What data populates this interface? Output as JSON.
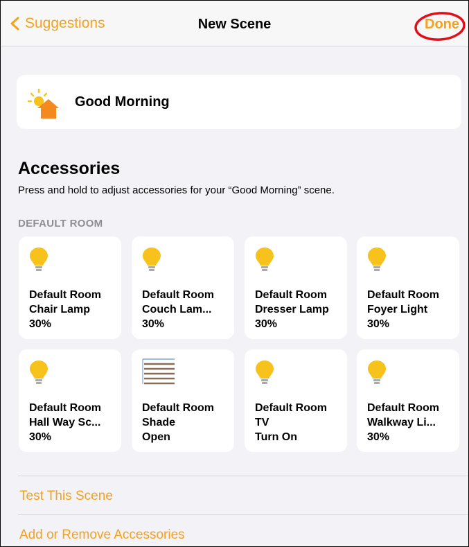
{
  "nav": {
    "back_label": "Suggestions",
    "title": "New Scene",
    "done_label": "Done"
  },
  "scene": {
    "name": "Good Morning",
    "icon": "sun-house-icon"
  },
  "accessories": {
    "title": "Accessories",
    "subtitle": "Press and hold to adjust accessories for your “Good Morning” scene.",
    "room_label": "DEFAULT ROOM",
    "tiles": [
      {
        "icon": "bulb-icon",
        "room": "Default Room",
        "name": "Chair Lamp",
        "state": "30%"
      },
      {
        "icon": "bulb-icon",
        "room": "Default Room",
        "name": "Couch Lam...",
        "state": "30%"
      },
      {
        "icon": "bulb-icon",
        "room": "Default Room",
        "name": "Dresser Lamp",
        "state": "30%"
      },
      {
        "icon": "bulb-icon",
        "room": "Default Room",
        "name": "Foyer Light",
        "state": "30%"
      },
      {
        "icon": "bulb-icon",
        "room": "Default Room",
        "name": "Hall Way Sc...",
        "state": "30%"
      },
      {
        "icon": "shade-icon",
        "room": "Default Room",
        "name": "Shade",
        "state": "Open"
      },
      {
        "icon": "bulb-icon",
        "room": "Default Room",
        "name": "TV",
        "state": "Turn On"
      },
      {
        "icon": "bulb-icon",
        "room": "Default Room",
        "name": "Walkway Li...",
        "state": "30%"
      }
    ]
  },
  "actions": {
    "test": "Test This Scene",
    "add_remove": "Add or Remove Accessories"
  },
  "colors": {
    "accent": "#f4a21d",
    "bulb": "#f7c21b",
    "annotation_circle": "#e0101a",
    "background": "#f2f2f7"
  }
}
